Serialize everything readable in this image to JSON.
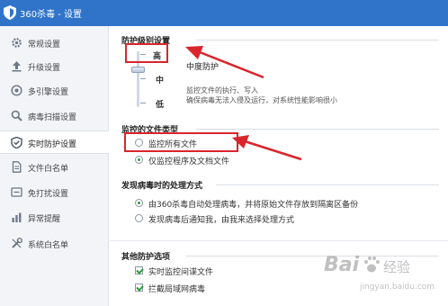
{
  "window": {
    "title": "360杀毒 - 设置",
    "titlebar_color": "#2f74c9"
  },
  "sidebar": {
    "items": [
      {
        "label": "常规设置",
        "icon": "gear-icon"
      },
      {
        "label": "升级设置",
        "icon": "upload-icon"
      },
      {
        "label": "多引擎设置",
        "icon": "engine-icon"
      },
      {
        "label": "病毒扫描设置",
        "icon": "search-icon"
      },
      {
        "label": "实时防护设置",
        "icon": "shield-icon",
        "active": true
      },
      {
        "label": "文件白名单",
        "icon": "file-icon"
      },
      {
        "label": "免打扰设置",
        "icon": "do-not-disturb-icon"
      },
      {
        "label": "异常提醒",
        "icon": "chart-icon"
      },
      {
        "label": "系统白名单",
        "icon": "tools-icon"
      }
    ]
  },
  "protection_level": {
    "title": "防护级别设置",
    "levels": [
      "高",
      "中",
      "低"
    ],
    "selected_level_name": "中度防护",
    "description_lines": [
      "监控文件的执行、写入",
      "确保病毒无法入侵及运行，对系统性能影响很小"
    ]
  },
  "monitored_types": {
    "title": "监控的文件类型",
    "options": [
      {
        "label": "监控所有文件",
        "selected": false
      },
      {
        "label": "仅监控程序及文档文件",
        "selected": true
      }
    ]
  },
  "virus_handling": {
    "title": "发现病毒时的处理方式",
    "options": [
      {
        "label": "由360杀毒自动处理病毒，并将原始文件存放到隔离区备份",
        "selected": true
      },
      {
        "label": "发现病毒后通知我，由我来选择处理方式",
        "selected": false
      }
    ]
  },
  "other_options": {
    "title": "其他防护选项",
    "checks": [
      {
        "label": "实时监控间谍文件",
        "checked": true
      },
      {
        "label": "拦截局域网病毒",
        "checked": true
      }
    ]
  },
  "annotation_color": "#d8262c",
  "accent_green": "#2a9a3c",
  "watermark": {
    "brand": "Bai",
    "tail": "经验",
    "sub": "jingyan.baidu.com"
  }
}
